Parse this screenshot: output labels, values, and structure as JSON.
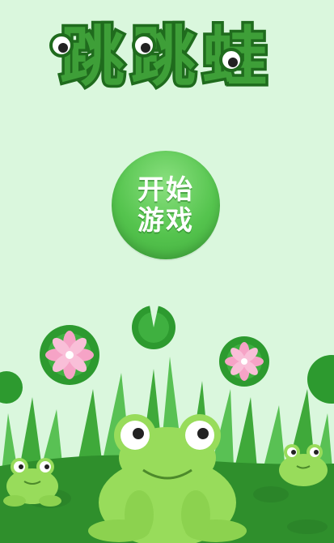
{
  "game": {
    "title": "跳跳蛙",
    "start_button_label_line1": "开始",
    "start_button_label_line2": "游戏"
  },
  "colors": {
    "background": "#daf7dd",
    "title_fill": "#3e9f38",
    "title_outline": "#1f6b1d",
    "button": "#55c44e",
    "grass_dark": "#2f8f2c",
    "grass_light": "#59c154",
    "lily_pad": "#2d9a2f",
    "lotus": "#f6a3c6",
    "frog_body": "#98dc5b"
  },
  "icons": [
    "lily-pad-icon",
    "lotus-flower-icon",
    "frog-icon",
    "grass-icon"
  ]
}
